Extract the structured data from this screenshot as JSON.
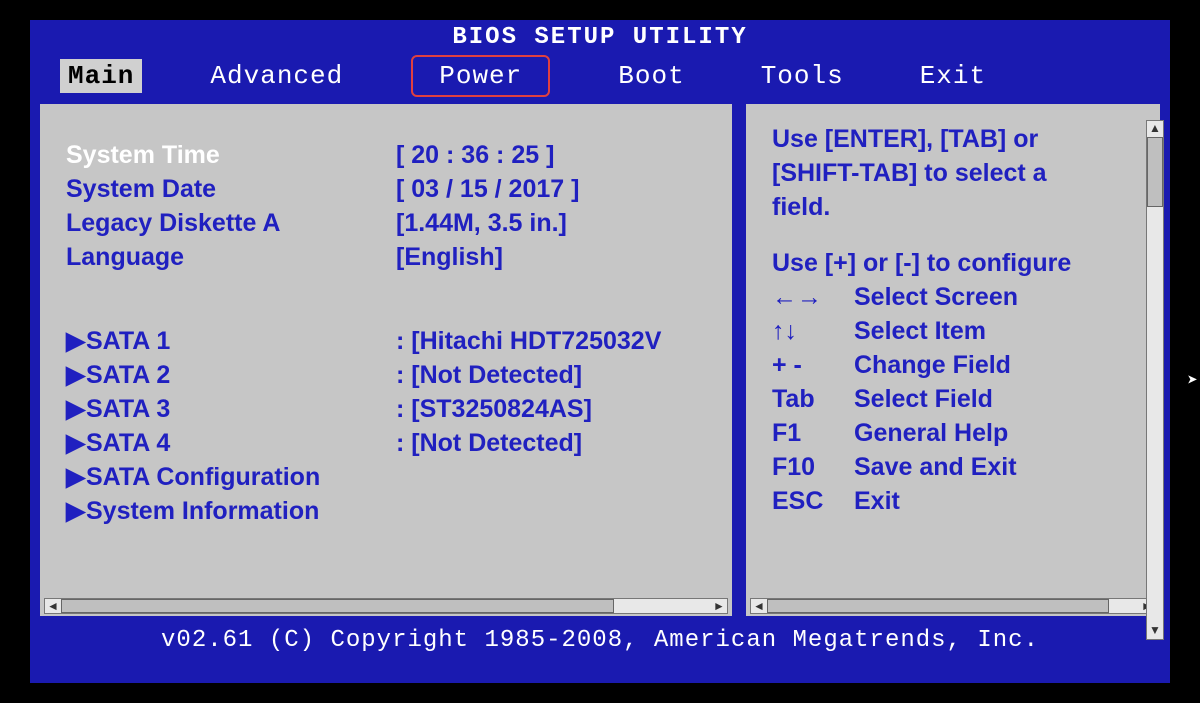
{
  "title": "BIOS SETUP UTILITY",
  "tabs": [
    "Main",
    "Advanced",
    "Power",
    "Boot",
    "Tools",
    "Exit"
  ],
  "active_tab": "Main",
  "highlighted_tab": "Power",
  "main": {
    "system_time_label": "System Time",
    "system_time_value": "[ 20 : 36 : 25 ]",
    "system_date_label": "System Date",
    "system_date_value": "[ 03 / 15 / 2017 ]",
    "diskette_label": "Legacy Diskette A",
    "diskette_value": "[1.44M, 3.5 in.]",
    "language_label": "Language",
    "language_value": "[English]",
    "sata": [
      {
        "label": "SATA 1",
        "value": "[Hitachi HDT725032V"
      },
      {
        "label": "SATA 2",
        "value": "[Not Detected]"
      },
      {
        "label": "SATA 3",
        "value": "[ST3250824AS]"
      },
      {
        "label": "SATA 4",
        "value": "[Not Detected]"
      }
    ],
    "sata_cfg": "SATA Configuration",
    "sysinfo": "System Information"
  },
  "help": {
    "l1": "Use [ENTER], [TAB] or",
    "l2": "[SHIFT-TAB] to select a",
    "l3": "field.",
    "l4": "Use [+] or [-] to configure",
    "nav": [
      {
        "k": "←→",
        "d": "Select Screen"
      },
      {
        "k": "↑↓",
        "d": "Select Item"
      },
      {
        "k": "+ -",
        "d": "Change Field"
      },
      {
        "k": "Tab",
        "d": "Select Field"
      },
      {
        "k": "F1",
        "d": "General Help"
      },
      {
        "k": "F10",
        "d": "Save and Exit"
      },
      {
        "k": "ESC",
        "d": "Exit"
      }
    ]
  },
  "footer": "v02.61 (C) Copyright 1985-2008, American Megatrends, Inc."
}
